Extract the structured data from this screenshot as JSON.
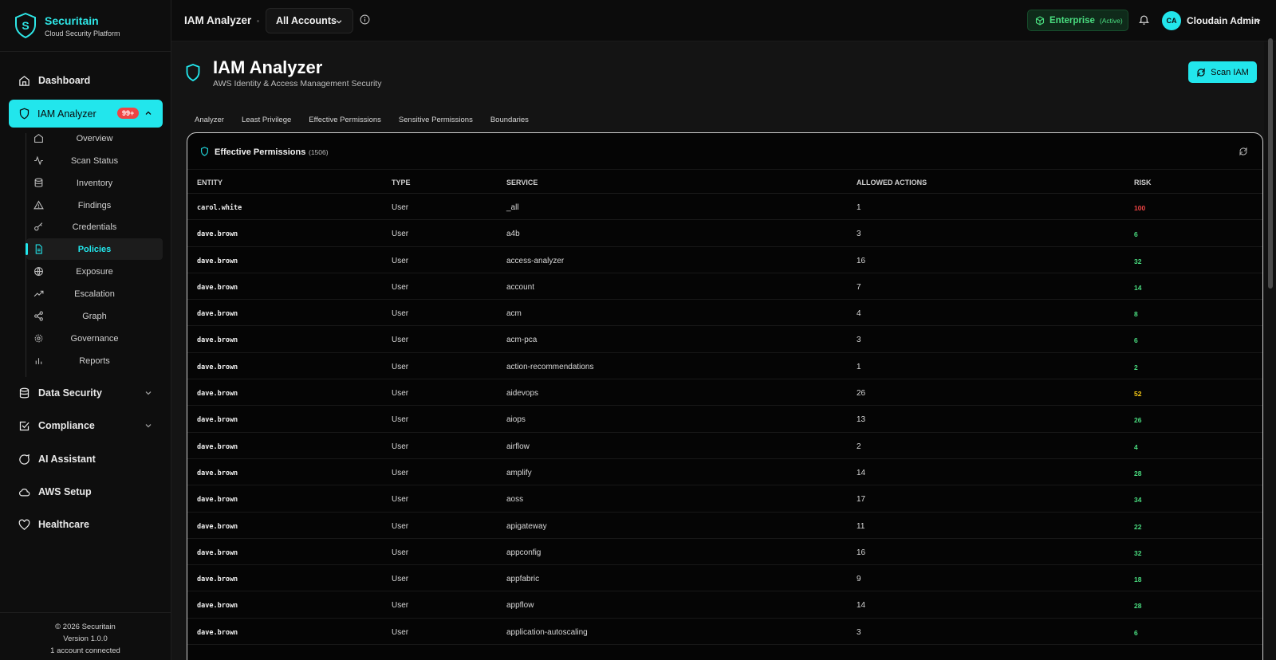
{
  "brand": {
    "name": "Securitain",
    "subtitle": "Cloud Security Platform"
  },
  "sidebar": {
    "dashboard": "Dashboard",
    "iam": {
      "label": "IAM Analyzer",
      "badge": "99+"
    },
    "sub_items": [
      {
        "label": "Overview",
        "icon": "home-icon"
      },
      {
        "label": "Scan Status",
        "icon": "activity-icon"
      },
      {
        "label": "Inventory",
        "icon": "database-icon"
      },
      {
        "label": "Findings",
        "icon": "alert-triangle-icon"
      },
      {
        "label": "Credentials",
        "icon": "key-icon"
      },
      {
        "label": "Policies",
        "icon": "file-text-icon",
        "active": true
      },
      {
        "label": "Exposure",
        "icon": "globe-icon"
      },
      {
        "label": "Escalation",
        "icon": "trending-up-icon"
      },
      {
        "label": "Graph",
        "icon": "share-icon"
      },
      {
        "label": "Governance",
        "icon": "settings-icon"
      },
      {
        "label": "Reports",
        "icon": "bar-chart-icon"
      }
    ],
    "groups": {
      "data_security": "Data Security",
      "compliance": "Compliance",
      "ai_assistant": "AI Assistant",
      "aws_setup": "AWS Setup",
      "healthcare": "Healthcare"
    },
    "footer": {
      "copyright": "© 2026 Securitain",
      "version": "Version 1.0.0",
      "accounts": "1 account connected"
    }
  },
  "topbar": {
    "title": "IAM Analyzer",
    "account_select": "All Accounts",
    "plan": {
      "name": "Enterprise",
      "status": "(Active)"
    },
    "user": {
      "initials": "CA",
      "name": "Cloudain Admin"
    }
  },
  "page": {
    "title": "IAM Analyzer",
    "subtitle": "AWS Identity & Access Management Security",
    "scan_button": "Scan IAM",
    "tabs": [
      "Analyzer",
      "Least Privilege",
      "Effective Permissions",
      "Sensitive Permissions",
      "Boundaries"
    ]
  },
  "card": {
    "title": "Effective Permissions",
    "count": "(1506)",
    "columns": [
      "ENTITY",
      "TYPE",
      "SERVICE",
      "ALLOWED ACTIONS",
      "RISK"
    ],
    "rows": [
      {
        "entity": "carol.white",
        "type": "User",
        "service": "_all",
        "actions": "1",
        "risk": "100",
        "risk_color": "#ef4444"
      },
      {
        "entity": "dave.brown",
        "type": "User",
        "service": "a4b",
        "actions": "3",
        "risk": "6",
        "risk_color": "#4ade80"
      },
      {
        "entity": "dave.brown",
        "type": "User",
        "service": "access-analyzer",
        "actions": "16",
        "risk": "32",
        "risk_color": "#4ade80"
      },
      {
        "entity": "dave.brown",
        "type": "User",
        "service": "account",
        "actions": "7",
        "risk": "14",
        "risk_color": "#4ade80"
      },
      {
        "entity": "dave.brown",
        "type": "User",
        "service": "acm",
        "actions": "4",
        "risk": "8",
        "risk_color": "#4ade80"
      },
      {
        "entity": "dave.brown",
        "type": "User",
        "service": "acm-pca",
        "actions": "3",
        "risk": "6",
        "risk_color": "#4ade80"
      },
      {
        "entity": "dave.brown",
        "type": "User",
        "service": "action-recommendations",
        "actions": "1",
        "risk": "2",
        "risk_color": "#4ade80"
      },
      {
        "entity": "dave.brown",
        "type": "User",
        "service": "aidevops",
        "actions": "26",
        "risk": "52",
        "risk_color": "#facc15"
      },
      {
        "entity": "dave.brown",
        "type": "User",
        "service": "aiops",
        "actions": "13",
        "risk": "26",
        "risk_color": "#4ade80"
      },
      {
        "entity": "dave.brown",
        "type": "User",
        "service": "airflow",
        "actions": "2",
        "risk": "4",
        "risk_color": "#4ade80"
      },
      {
        "entity": "dave.brown",
        "type": "User",
        "service": "amplify",
        "actions": "14",
        "risk": "28",
        "risk_color": "#4ade80"
      },
      {
        "entity": "dave.brown",
        "type": "User",
        "service": "aoss",
        "actions": "17",
        "risk": "34",
        "risk_color": "#4ade80"
      },
      {
        "entity": "dave.brown",
        "type": "User",
        "service": "apigateway",
        "actions": "11",
        "risk": "22",
        "risk_color": "#4ade80"
      },
      {
        "entity": "dave.brown",
        "type": "User",
        "service": "appconfig",
        "actions": "16",
        "risk": "32",
        "risk_color": "#4ade80"
      },
      {
        "entity": "dave.brown",
        "type": "User",
        "service": "appfabric",
        "actions": "9",
        "risk": "18",
        "risk_color": "#4ade80"
      },
      {
        "entity": "dave.brown",
        "type": "User",
        "service": "appflow",
        "actions": "14",
        "risk": "28",
        "risk_color": "#4ade80"
      },
      {
        "entity": "dave.brown",
        "type": "User",
        "service": "application-autoscaling",
        "actions": "3",
        "risk": "6",
        "risk_color": "#4ade80"
      }
    ]
  },
  "colors": {
    "accent": "#22e6ec",
    "danger": "#ef4444",
    "success": "#4ade80",
    "warning": "#facc15"
  }
}
